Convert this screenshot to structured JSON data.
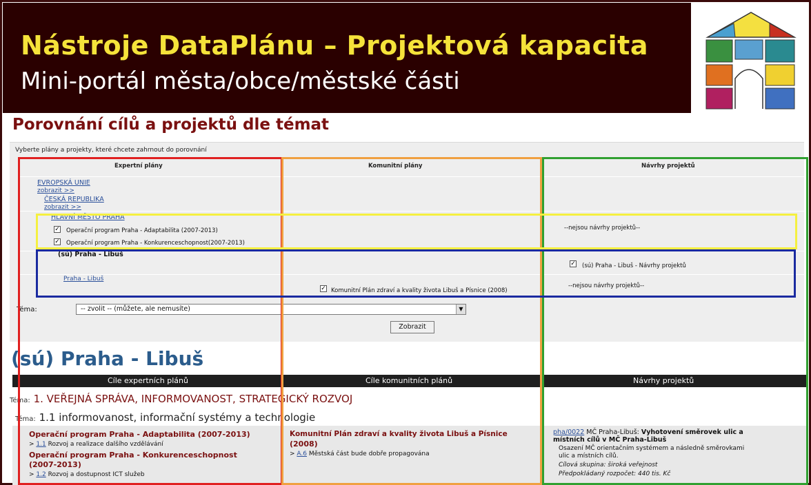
{
  "banner": {
    "title": "Nástroje DataPlánu – Projektová kapacita",
    "subtitle": "Mini-portál města/obce/městské části"
  },
  "section_title": "Porovnání cílů a projektů dle témat",
  "instruction": "Vyberte plány a projekty, které chcete zahrnout do porovnání",
  "columns": {
    "expert": "Expertní plány",
    "community": "Komunitní plány",
    "proposals": "Návrhy projektů"
  },
  "tree": {
    "eu": "EVROPSKÁ UNIE",
    "show1": "zobrazit >>",
    "cz": "ČESKÁ REPUBLIKA",
    "show2": "zobrazit >>",
    "prague": "HLAVNÍ MĚSTO PRAHA",
    "op_adapt": "Operační program Praha - Adaptabilita (2007-2013)",
    "op_konk": "Operační program Praha - Konkurenceschopnost(2007-2013)",
    "libus_head": "(sú) Praha - Libuš",
    "libus_link": "Praha - Libuš"
  },
  "community_plan": "Komunitní Plán zdraví a kvality života Libuš a Písnice (2008)",
  "proposals": {
    "none1": "--nejsou návrhy projektů--",
    "libus_check": "(sú) Praha - Libuš - Návrhy projektů",
    "none2": "--nejsou návrhy projektů--"
  },
  "tema": {
    "label": "Téma:",
    "select_value": "-- zvolit -- (můžete, ale nemusíte)"
  },
  "show_button": "Zobrazit",
  "results": {
    "heading": "(sú) Praha - Libuš",
    "col_expert": "Cíle expertních plánů",
    "col_community": "Cíle komunitních plánů",
    "col_proposals": "Návrhy projektů",
    "tema_prefix": "Téma:",
    "tema1": "1. VEŘEJNÁ SPRÁVA, INFORMOVANOST, STRATEGICKÝ ROZVOJ",
    "tema2": "1.1 informovanost, informační systémy a technologie",
    "expert": {
      "title1": "Operační program Praha - Adaptabilita (2007-2013)",
      "goal1_num": "1.1",
      "goal1_text": "Rozvoj a realizace dalšího vzdělávání",
      "title2": "Operační program Praha - Konkurenceschopnost",
      "title2b": "(2007-2013)",
      "goal2_num": "1.2",
      "goal2_text": "Rozvoj a dostupnost ICT služeb"
    },
    "community": {
      "title": "Komunitní Plán zdraví a kvality života Libuš a Písnice",
      "year": "(2008)",
      "goal_num": "A.6",
      "goal_text": "Městská část bude dobře propagována"
    },
    "proposal": {
      "code": "pha/0022",
      "org": "MČ Praha-Libuš:",
      "title1": "Vyhotovení směrovek ulic a",
      "title2": "místních cílů v MČ Praha-Libuš",
      "desc1": "Osazení MČ orientačním systémem a následně směrovkami",
      "desc2": "ulic a místních cílů.",
      "target": "Cílová skupina: široká veřejnost",
      "budget": "Předpokládaný rozpočet: 440 tis. Kč"
    }
  },
  "colors": {
    "banner_bg": "#2a0000",
    "title_yellow": "#f5e33a",
    "red_box": "#e02020",
    "orange_box": "#f0a040",
    "green_box": "#30a030",
    "yellow_box": "#f5f040",
    "blue_box": "#1a2aa0"
  }
}
